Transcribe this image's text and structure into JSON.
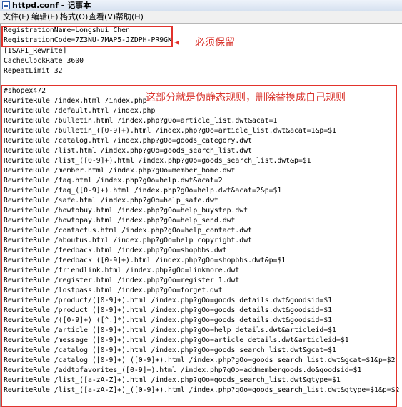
{
  "window": {
    "title": "httpd.conf - 记事本"
  },
  "menu": [
    "文件(F)",
    "编辑(E)",
    "格式(O)",
    "查看(V)",
    "帮助(H)"
  ],
  "lines": [
    "RegistrationName=Longshui Chen",
    "RegistrationCode=7Z3NU-7MAP5-JZDPH-PR9GK",
    "[ISAPI_Rewrite]",
    "CacheClockRate 3600",
    "RepeatLimit 32",
    "",
    "#shopex472",
    "RewriteRule /index.html /index.php",
    "RewriteRule /default.html /index.php",
    "RewriteRule /bulletin.html /index.php?gOo=article_list.dwt&acat=1",
    "RewriteRule /bulletin_([0-9]+).html /index.php?gOo=article_list.dwt&acat=1&p=$1",
    "RewriteRule /catalog.html /index.php?gOo=goods_category.dwt",
    "RewriteRule /list.html /index.php?gOo=goods_search_list.dwt",
    "RewriteRule /list_([0-9]+).html /index.php?gOo=goods_search_list.dwt&p=$1",
    "RewriteRule /member.html /index.php?gOo=member_home.dwt",
    "RewriteRule /faq.html /index.php?gOo=help.dwt&acat=2",
    "RewriteRule /faq_([0-9]+).html /index.php?gOo=help.dwt&acat=2&p=$1",
    "RewriteRule /safe.html /index.php?gOo=help_safe.dwt",
    "RewriteRule /howtobuy.html /index.php?gOo=help_buystep.dwt",
    "RewriteRule /howtopay.html /index.php?gOo=help_send.dwt",
    "RewriteRule /contactus.html /index.php?gOo=help_contact.dwt",
    "RewriteRule /aboutus.html /index.php?gOo=help_copyright.dwt",
    "RewriteRule /feedback.html /index.php?gOo=shopbbs.dwt",
    "RewriteRule /feedback_([0-9]+).html /index.php?gOo=shopbbs.dwt&p=$1",
    "RewriteRule /friendlink.html /index.php?gOo=linkmore.dwt",
    "RewriteRule /register.html /index.php?gOo=register_1.dwt",
    "RewriteRule /lostpass.html /index.php?gOo=forget.dwt",
    "RewriteRule /product/([0-9]+).html /index.php?gOo=goods_details.dwt&goodsid=$1",
    "RewriteRule /product_([0-9]+).html /index.php?gOo=goods_details.dwt&goodsid=$1",
    "RewriteRule /([0-9]+)_([^.]*).html /index.php?gOo=goods_details.dwt&goodsid=$1",
    "RewriteRule /article_([0-9]+).html /index.php?gOo=help_details.dwt&articleid=$1",
    "RewriteRule /message_([0-9]+).html /index.php?gOo=article_details.dwt&articleid=$1",
    "RewriteRule /catalog_([0-9]+).html /index.php?gOo=goods_search_list.dwt&gcat=$1",
    "RewriteRule /catalog_([0-9]+)_([0-9]+).html /index.php?gOo=goods_search_list.dwt&gcat=$1&p=$2",
    "RewriteRule /addtofavorites_([0-9]+).html /index.php?gOo=addmembergoods.do&goodsid=$1",
    "RewriteRule /list_([a-zA-Z]+).html /index.php?gOo=goods_search_list.dwt&gtype=$1",
    "RewriteRule /list_([a-zA-Z]+)_([0-9]+).html /index.php?gOo=goods_search_list.dwt&gtype=$1&p=$2"
  ],
  "annotations": {
    "keep": "必须保留",
    "rules": "这部分就是伪静态规则，删除替换成自己规则"
  },
  "colors": {
    "annotation": "#e2332c"
  }
}
